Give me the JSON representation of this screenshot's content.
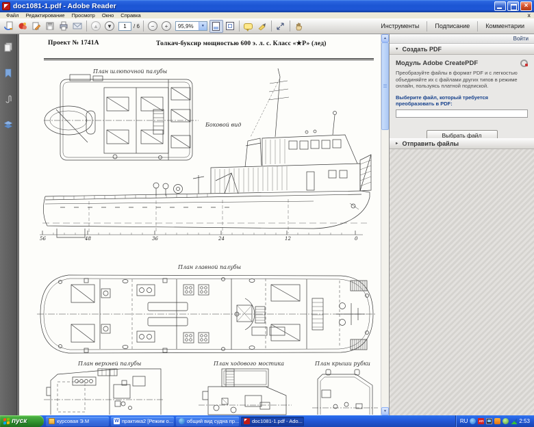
{
  "window": {
    "title": "doc1081-1.pdf - Adobe Reader"
  },
  "menubar": {
    "items": [
      "Файл",
      "Редактирование",
      "Просмотр",
      "Окно",
      "Справка"
    ]
  },
  "glyphs": {
    "close_x": "×",
    "menu_close_x": "x",
    "page_up": "▲",
    "page_down": "▼",
    "zoom_minus": "−",
    "zoom_plus": "+",
    "combo_arrow": "▼",
    "scroll_up": "▲",
    "scroll_down": "▼",
    "section_open": "▼",
    "section_closed": "►"
  },
  "toolbar": {
    "page_current": "1",
    "page_total": "/ 6",
    "zoom_value": "95,9%",
    "right_buttons": [
      "Инструменты",
      "Подписание",
      "Комментарии"
    ]
  },
  "right_panel": {
    "sign_in": "Войти",
    "create_pdf": {
      "header": "Создать PDF",
      "module_title": "Модуль Adobe CreatePDF",
      "description": "Преобразуйте файлы в формат PDF и с легкостью объединяйте их с файлами других типов в режиме онлайн, пользуясь платной подпиской.",
      "file_label": "Выберите файл, который требуется преобразовать в PDF:",
      "file_input_value": "",
      "choose_file_button": "Выбрать файл"
    },
    "send_files_header": "Отправить файлы"
  },
  "document": {
    "project_label": "Проект  №  1741А",
    "title": "Толкач-буксир  мощностью  600 э. л. с.  Класс  «★Р»  (лед)",
    "plans": {
      "boat_deck": "План шлюпочной палубы",
      "side_view": "Боковой вид",
      "main_deck": "План главной палубы",
      "upper_deck": "План верхней палубы",
      "bridge": "План ходового мостика",
      "cabin_roof": "План крыши рубки"
    },
    "frame_numbers": [
      "56",
      "48",
      "36",
      "24",
      "12",
      "0"
    ]
  },
  "taskbar": {
    "start": "пуск",
    "items": [
      "курсовая Э.М",
      "практика2 [Режим о...",
      "общий вид судна пр...",
      "doc1081-1.pdf - Ado..."
    ],
    "tray": {
      "lang": "RU",
      "time": "2:53"
    }
  },
  "colors": {
    "titlebar_blue": "#1c55d4",
    "taskbar_blue": "#2258d8",
    "start_green": "#2f8f2c",
    "close_red": "#d4512c",
    "link_blue": "#16418c"
  }
}
